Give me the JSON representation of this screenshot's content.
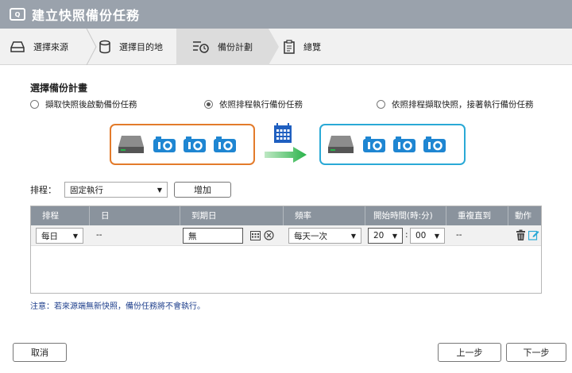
{
  "window": {
    "title": "建立快照備份任務",
    "logo_text": "Q"
  },
  "steps": [
    {
      "label": "選擇來源"
    },
    {
      "label": "選擇目的地"
    },
    {
      "label": "備份計劃"
    },
    {
      "label": "總覽"
    }
  ],
  "plan": {
    "title": "選擇備份計畫",
    "options": [
      {
        "label": "擷取快照後啟動備份任務",
        "selected": false
      },
      {
        "label": "依照排程執行備份任務",
        "selected": true
      },
      {
        "label": "依照排程擷取快照，接著執行備份任務",
        "selected": false
      }
    ]
  },
  "diagram": {
    "source_color": "#e37b2b",
    "dest_color": "#2aa9d6",
    "arrow_color": "#2ab34a",
    "camera_color": "#1f86d2"
  },
  "schedule": {
    "label": "排程：",
    "selected": "固定執行",
    "add_label": "增加"
  },
  "table": {
    "headers": [
      "排程",
      "日",
      "到期日",
      "頻率",
      "開始時間(時:分)",
      "重複直到",
      "動作"
    ],
    "row": {
      "schedule": "每日",
      "day": "--",
      "expiry": "無",
      "frequency": "每天一次",
      "hour": "20",
      "colon": ":",
      "minute": "00",
      "repeat_until": "--"
    }
  },
  "note": "注意：若來源端無新快照，備份任務將不會執行。",
  "footer": {
    "cancel": "取消",
    "prev": "上一步",
    "next": "下一步"
  }
}
